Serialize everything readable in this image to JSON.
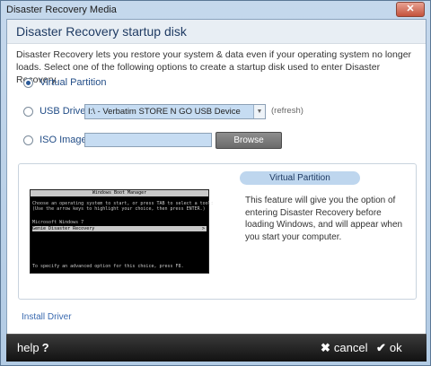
{
  "window": {
    "title": "Disaster Recovery Media",
    "close_glyph": "✕"
  },
  "heading": "Disaster Recovery startup disk",
  "description": "Disaster Recovery lets you restore your system & data even if your operating system no longer loads. Select one of the following options to create a startup disk used to enter Disaster Recovery.",
  "options": {
    "virtual_partition": {
      "label": "Virtual Partition",
      "checked": true
    },
    "usb_drive": {
      "label": "USB Drive",
      "checked": false,
      "selected_device": "I:\\ - Verbatim STORE N GO USB Device",
      "refresh_label": "(refresh)"
    },
    "iso_image": {
      "label": "ISO Image",
      "checked": false,
      "path_value": "",
      "browse_label": "Browse"
    }
  },
  "info_panel": {
    "badge": "Virtual Partition",
    "text": "This feature will give you the option of entering Disaster Recovery before loading Windows, and will appear when you start your computer.",
    "boot_screen": {
      "title": "Windows Boot Manager",
      "line1": "Choose an operating system to start, or press TAB to select a tool:",
      "line2": "(Use the arrow keys to highlight your choice, then press ENTER.)",
      "item1": "Microsoft Windows 7",
      "item2": "Genie Disaster Recovery",
      "item2_marker": ">",
      "footer": "To specify an advanced option for this choice, press F8."
    }
  },
  "links": {
    "install_driver": "Install Driver"
  },
  "footer": {
    "help_label": "help",
    "help_glyph": "?",
    "cancel_label": "cancel",
    "cancel_glyph": "✖",
    "ok_label": "ok",
    "ok_glyph": "✔"
  },
  "colors": {
    "accent": "#224d87",
    "field_bg": "#c6dcf2",
    "badge_bg": "#bed6ee",
    "footer_bg": "#1a1a1a"
  }
}
